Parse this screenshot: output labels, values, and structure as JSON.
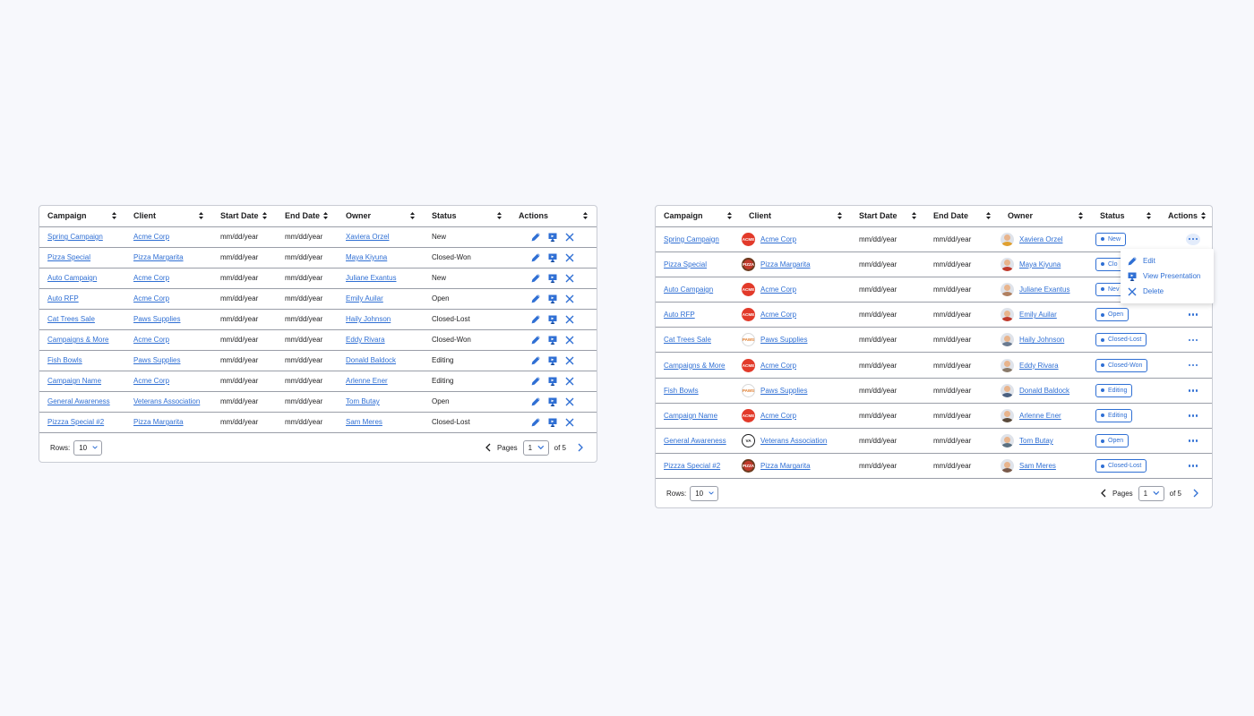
{
  "colors": {
    "accent": "#2f6fd4",
    "border": "#9a9ea8",
    "background": "#f7f8fc"
  },
  "table1": {
    "headers": [
      "Campaign",
      "Client",
      "Start Date",
      "End Date",
      "Owner",
      "Status",
      "Actions"
    ],
    "rows": [
      {
        "campaign": "Spring Campaign",
        "client": "Acme Corp",
        "start": "mm/dd/year",
        "end": "mm/dd/year",
        "owner": "Xaviera Orzel",
        "status": "New"
      },
      {
        "campaign": "Pizza Special",
        "client": "Pizza Margarita",
        "start": "mm/dd/year",
        "end": "mm/dd/year",
        "owner": "Maya Kiyuna",
        "status": "Closed-Won"
      },
      {
        "campaign": "Auto Campaign",
        "client": "Acme Corp",
        "start": "mm/dd/year",
        "end": "mm/dd/year",
        "owner": "Juliane Exantus",
        "status": "New"
      },
      {
        "campaign": "Auto RFP",
        "client": "Acme Corp",
        "start": "mm/dd/year",
        "end": "mm/dd/year",
        "owner": "Emily Auilar",
        "status": "Open"
      },
      {
        "campaign": "Cat Trees Sale",
        "client": "Paws Supplies",
        "start": "mm/dd/year",
        "end": "mm/dd/year",
        "owner": "Haily Johnson",
        "status": "Closed-Lost"
      },
      {
        "campaign": "Campaigns & More",
        "client": "Acme Corp",
        "start": "mm/dd/year",
        "end": "mm/dd/year",
        "owner": "Eddy Rivara",
        "status": "Closed-Won"
      },
      {
        "campaign": "Fish Bowls",
        "client": "Paws Supplies",
        "start": "mm/dd/year",
        "end": "mm/dd/year",
        "owner": "Donald Baldock",
        "status": "Editing"
      },
      {
        "campaign": "Campaign Name",
        "client": "Acme Corp",
        "start": "mm/dd/year",
        "end": "mm/dd/year",
        "owner": "Arlenne Ener",
        "status": "Editing"
      },
      {
        "campaign": "General Awareness",
        "client": "Veterans Association",
        "start": "mm/dd/year",
        "end": "mm/dd/year",
        "owner": "Tom Butay",
        "status": "Open"
      },
      {
        "campaign": "Pizzza Special #2",
        "client": "Pizza Margarita",
        "start": "mm/dd/year",
        "end": "mm/dd/year",
        "owner": "Sam Meres",
        "status": "Closed-Lost"
      }
    ],
    "action_icons": [
      "pencil-icon",
      "presentation-icon",
      "close-icon"
    ],
    "footer": {
      "rows_label": "Rows:",
      "rows_value": "10",
      "pages_label": "Pages",
      "page_value": "1",
      "of_label": "of 5"
    }
  },
  "table2": {
    "headers": [
      "Campaign",
      "Client",
      "Start Date",
      "End Date",
      "Owner",
      "Status",
      "Actions"
    ],
    "rows": [
      {
        "campaign": "Spring Campaign",
        "client": "Acme Corp",
        "logo": "ACME",
        "start": "mm/dd/year",
        "end": "mm/dd/year",
        "owner": "Xaviera Orzel",
        "status": "New"
      },
      {
        "campaign": "Pizza Special",
        "client": "Pizza Margarita",
        "logo": "PIZZA",
        "start": "mm/dd/year",
        "end": "mm/dd/year",
        "owner": "Maya Kiyuna",
        "status": "Clo"
      },
      {
        "campaign": "Auto Campaign",
        "client": "Acme Corp",
        "logo": "ACME",
        "start": "mm/dd/year",
        "end": "mm/dd/year",
        "owner": "Juliane Exantus",
        "status": "Nev"
      },
      {
        "campaign": "Auto RFP",
        "client": "Acme Corp",
        "logo": "ACME",
        "start": "mm/dd/year",
        "end": "mm/dd/year",
        "owner": "Emily Auilar",
        "status": "Open"
      },
      {
        "campaign": "Cat Trees Sale",
        "client": "Paws Supplies",
        "logo": "PAWS",
        "start": "mm/dd/year",
        "end": "mm/dd/year",
        "owner": "Haily Johnson",
        "status": "Closed-Lost"
      },
      {
        "campaign": "Campaigns & More",
        "client": "Acme Corp",
        "logo": "ACME",
        "start": "mm/dd/year",
        "end": "mm/dd/year",
        "owner": "Eddy Rivara",
        "status": "Closed-Won"
      },
      {
        "campaign": "Fish Bowls",
        "client": "Paws Supplies",
        "logo": "PAWS",
        "start": "mm/dd/year",
        "end": "mm/dd/year",
        "owner": "Donald Baldock",
        "status": "Editing"
      },
      {
        "campaign": "Campaign Name",
        "client": "Acme Corp",
        "logo": "ACME",
        "start": "mm/dd/year",
        "end": "mm/dd/year",
        "owner": "Arlenne Ener",
        "status": "Editing"
      },
      {
        "campaign": "General Awareness",
        "client": "Veterans Association",
        "logo": "VA",
        "start": "mm/dd/year",
        "end": "mm/dd/year",
        "owner": "Tom Butay",
        "status": "Open"
      },
      {
        "campaign": "Pizzza Special #2",
        "client": "Pizza Margarita",
        "logo": "PIZZA",
        "start": "mm/dd/year",
        "end": "mm/dd/year",
        "owner": "Sam Meres",
        "status": "Closed-Lost"
      }
    ],
    "avatar_colors": [
      "#e0a030",
      "#c0392b",
      "#b08060",
      "#c0392b",
      "#6a7a90",
      "#8a7a6a",
      "#4a6080",
      "#5a4a3a",
      "#5a7080",
      "#7a5a4a"
    ],
    "menu": [
      {
        "label": "Edit",
        "icon": "pencil-icon"
      },
      {
        "label": "View Presentation",
        "icon": "presentation-icon"
      },
      {
        "label": "Delete",
        "icon": "close-icon"
      }
    ],
    "footer": {
      "rows_label": "Rows:",
      "rows_value": "10",
      "pages_label": "Pages",
      "page_value": "1",
      "of_label": "of 5"
    }
  }
}
